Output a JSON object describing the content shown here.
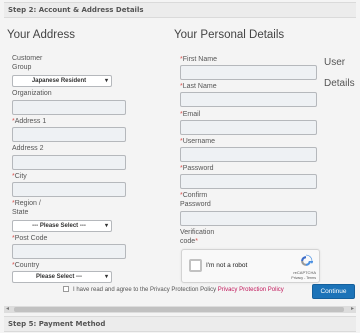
{
  "steps": {
    "current": "Step 2: Account & Address Details",
    "next": "Step 5: Payment Method"
  },
  "address": {
    "title": "Your Address",
    "customer_group_label": "Customer Group",
    "customer_group_line1": "Customer",
    "customer_group_line2": "Group",
    "customer_group_value": "Japanese Resident",
    "organization_label": "Organization",
    "address1_label": "Address 1",
    "address2_label": "Address 2",
    "city_label": "City",
    "region_line1": "Region /",
    "region_line2": "State",
    "region_value": "--- Please Select ---",
    "post_code_label": "Post Code",
    "country_label": "Country",
    "country_value": "Please Select ---"
  },
  "personal": {
    "title": "Your Personal Details",
    "side_line1": "User",
    "side_line2": "Details",
    "first_name_label": "First Name",
    "last_name_label": "Last Name",
    "email_label": "Email",
    "username_label": "Username",
    "password_label": "Password",
    "confirm_line1": "Confirm",
    "confirm_line2": "Password",
    "verification_line1": "Verification",
    "verification_line2": "code"
  },
  "captcha": {
    "checkbox_label": "I'm not a robot",
    "brand": "reCAPTCHA",
    "links": "Privacy - Terms"
  },
  "agreement": {
    "text": "I have read and agree to the Privacy Protection Policy",
    "link": "Privacy Protection Policy"
  },
  "actions": {
    "continue_label": "Continue"
  },
  "colors": {
    "required": "#d9534f",
    "button": "#1c73b8",
    "link": "#c2185b"
  }
}
